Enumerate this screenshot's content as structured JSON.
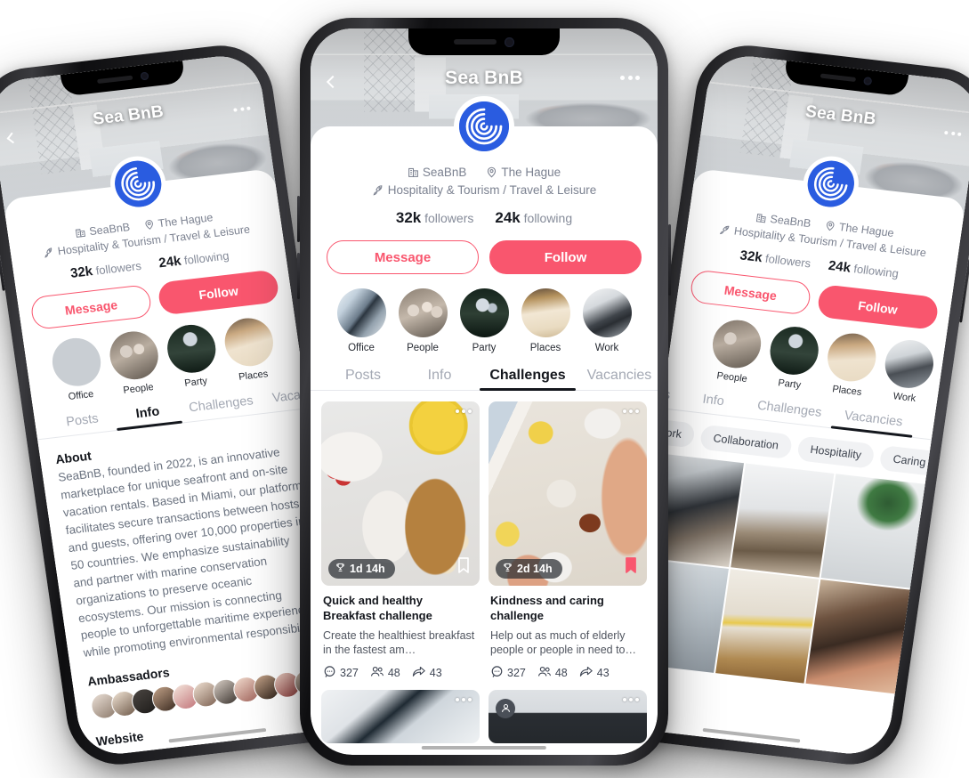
{
  "app": {
    "brand_accent": "#f9566e",
    "logo_color": "#2a5ce0",
    "dark_text": "#14171d"
  },
  "profile": {
    "cover_title": "Sea BnB",
    "back_icon": "chevron-left-icon",
    "more_icon": "more-horizontal-icon",
    "logo_icon": "seabnb-spiral-logo",
    "company_icon": "building-icon",
    "company_name": "SeaBnB",
    "location_icon": "map-pin-icon",
    "location": "The Hague",
    "industry_icon": "rocket-icon",
    "industry": "Hospitality & Tourism / Travel & Leisure",
    "followers_count": "32k",
    "followers_label": "followers",
    "following_count": "24k",
    "following_label": "following",
    "message_label": "Message",
    "follow_label": "Follow"
  },
  "stories": [
    {
      "label": "Office",
      "image": "office-towers-photo"
    },
    {
      "label": "People",
      "image": "team-highfive-photo"
    },
    {
      "label": "Party",
      "image": "party-disco-photo"
    },
    {
      "label": "Places",
      "image": "beige-sofa-photo"
    },
    {
      "label": "Work",
      "image": "desk-laptops-photo"
    }
  ],
  "tabs": [
    {
      "label": "Posts"
    },
    {
      "label": "Info"
    },
    {
      "label": "Challenges"
    },
    {
      "label": "Vacancies"
    }
  ],
  "center_phone": {
    "active_tab": "Challenges",
    "challenges": [
      {
        "timer_icon": "trophy-icon",
        "timer": "1d 14h",
        "bookmarked": false,
        "bookmark_icon": "bookmark-icon",
        "more_icon": "more-horizontal-icon",
        "title": "Quick and healthy Breakfast challenge",
        "description": "Create the healthiest breakfast in the fastest am…",
        "image": "breakfast-bowl-toast-juice-photo",
        "comments_icon": "comment-icon",
        "comments": "327",
        "participants_icon": "people-icon",
        "participants": "48",
        "shares_icon": "share-icon",
        "shares": "43"
      },
      {
        "timer_icon": "trophy-icon",
        "timer": "2d 14h",
        "bookmarked": true,
        "bookmark_icon": "bookmark-filled-icon",
        "more_icon": "more-horizontal-icon",
        "title": "Kindness and caring challenge",
        "description": "Help out as much of elderly people or people in need to…",
        "image": "table-tea-hands-crafts-photo",
        "comments_icon": "comment-icon",
        "comments": "327",
        "participants_icon": "people-icon",
        "participants": "48",
        "shares_icon": "share-icon",
        "shares": "43"
      }
    ],
    "partial_cards": [
      {
        "image": "office-interior-photo",
        "more_icon": "more-horizontal-icon",
        "avatar_icon": null
      },
      {
        "image": "dark-banner-photo",
        "more_icon": "more-horizontal-icon",
        "avatar_icon": "person-avatar-icon"
      }
    ]
  },
  "left_phone": {
    "active_tab": "Info",
    "about_heading": "About",
    "about_text": "SeaBnB, founded in 2022, is an innovative marketplace for unique seafront and on-site vacation rentals. Based in Miami, our platform facilitates secure transactions between hosts and guests, offering over 10,000 properties in 50 countries. We emphasize sustainability and partner with marine conservation organizations to preserve oceanic ecosystems. Our mission is connecting people to unforgettable maritime experiences while promoting environmental responsibility.",
    "ambassadors_heading": "Ambassadors",
    "ambassadors_count": 11,
    "website_heading": "Website"
  },
  "right_phone": {
    "active_tab": "Vacancies",
    "chips": [
      "Work",
      "Collaboration",
      "Hospitality",
      "Caring"
    ],
    "photos": [
      "woman-sitting-chair-photo",
      "bright-loft-desk-photo",
      "monstera-laptop-desk-photo",
      "open-office-photo",
      "marble-meeting-room-photo",
      "two-women-cafe-photo"
    ]
  }
}
